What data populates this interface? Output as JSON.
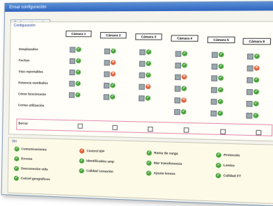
{
  "window": {
    "title": "Ensar configuración"
  },
  "tabs": [
    "Configuración modes"
  ],
  "panel": {
    "legend": "Configuración"
  },
  "cameras": [
    "Cámara 1",
    "Cámara 2",
    "Cámara 3",
    "Cámara 4",
    "Cámara 5",
    "Cámara 6"
  ],
  "rows": [
    {
      "label": "Desplazados",
      "status": [
        "ok",
        "ok",
        "ok",
        "ok",
        "ok",
        "ok"
      ]
    },
    {
      "label": "Fechas",
      "status": [
        "ok",
        "bad",
        "ok",
        "ok",
        "ok",
        "bad"
      ]
    },
    {
      "label": "Vías reportables",
      "status": [
        "ok",
        "bad",
        "ok",
        "bad",
        "ok",
        "ok"
      ]
    },
    {
      "label": "Potencia ventilados",
      "status": [
        "ok",
        "ok",
        "bad",
        "ok",
        "ok",
        "ok"
      ]
    },
    {
      "label": "Cómo funcionarán",
      "status": [
        "ok",
        "ok",
        "ok",
        "bad",
        "ok",
        "ok"
      ]
    },
    {
      "label": "Cortes utilización",
      "status": [
        "",
        "",
        "",
        "ok",
        "ok",
        "ok"
      ]
    }
  ],
  "select_row": {
    "label": "Borrar"
  },
  "bottom": {
    "legend": "Ver",
    "items": [
      [
        "Comunicaciones",
        "Errores",
        "Desconexión vida",
        "Cancel geográficos"
      ],
      [
        "Control IDP",
        "Identificados amp",
        "Calidad conexión"
      ],
      [
        "Rama de carga",
        "Mar transferencia",
        "Ajuste lenses"
      ],
      [
        "Protocolo",
        "Lentes",
        "Calidad FT"
      ]
    ]
  }
}
